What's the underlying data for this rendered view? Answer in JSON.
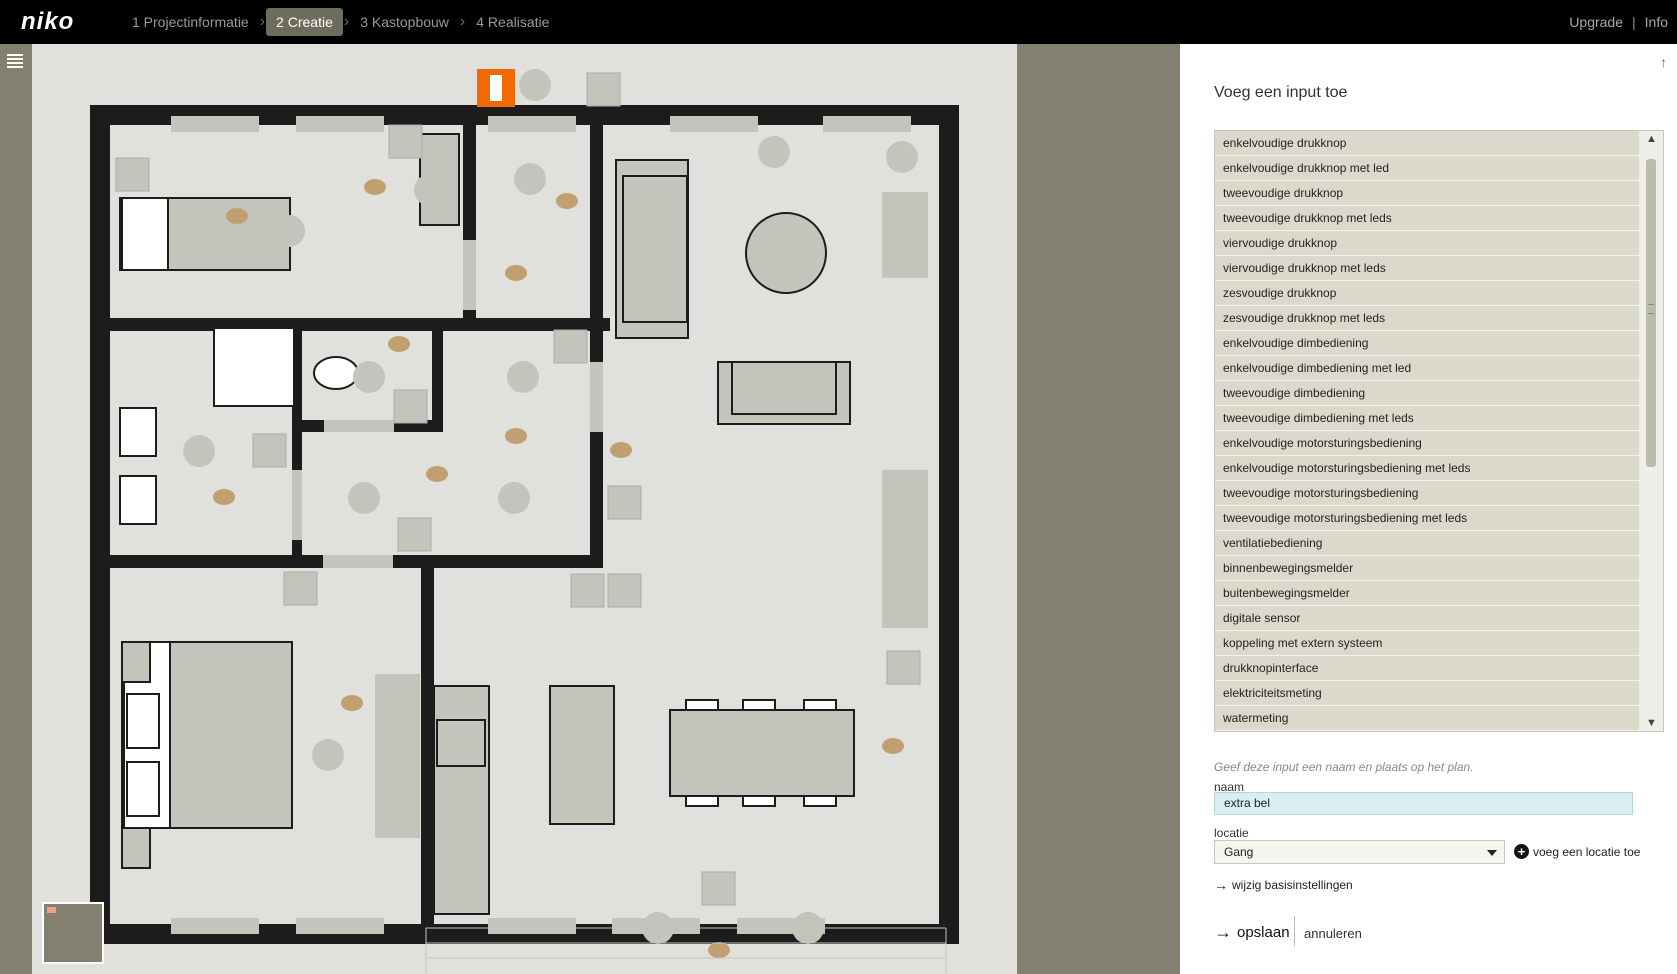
{
  "app": {
    "logo": "niko"
  },
  "steps": [
    {
      "label": "1 Projectinformatie",
      "active": false
    },
    {
      "label": "2 Creatie",
      "active": true
    },
    {
      "label": "3 Kastopbouw",
      "active": false
    },
    {
      "label": "4 Realisatie",
      "active": false
    }
  ],
  "toplinks": {
    "upgrade": "Upgrade",
    "separator": "|",
    "info": "Info"
  },
  "panel": {
    "title": "Voeg een input toe",
    "input_types": [
      "enkelvoudige drukknop",
      "enkelvoudige drukknop met led",
      "tweevoudige drukknop",
      "tweevoudige drukknop met leds",
      "viervoudige drukknop",
      "viervoudige drukknop met leds",
      "zesvoudige drukknop",
      "zesvoudige drukknop met leds",
      "enkelvoudige dimbediening",
      "enkelvoudige dimbediening met led",
      "tweevoudige dimbediening",
      "tweevoudige dimbediening met leds",
      "enkelvoudige motorsturingsbediening",
      "enkelvoudige motorsturingsbediening met leds",
      "tweevoudige motorsturingsbediening",
      "tweevoudige motorsturingsbediening met leds",
      "ventilatiebediening",
      "binnenbewegingsmelder",
      "buitenbewegingsmelder",
      "digitale sensor",
      "koppeling met extern systeem",
      "drukknopinterface",
      "elektriciteitsmeting",
      "watermeting"
    ],
    "hint": "Geef deze input een naam en plaats op het plan.",
    "name_label": "naam",
    "name_value": "extra bel",
    "location_label": "locatie",
    "location_value": "Gang",
    "add_location": "voeg een locatie toe",
    "change_settings": "wijzig basisinstellingen",
    "save": "opslaan",
    "cancel": "annuleren"
  },
  "colors": {
    "topbar": "#000000",
    "olive": "#838070",
    "canvas": "#e0e0dc",
    "wall": "#1c1c1c",
    "furniture": "#c5c4bc",
    "lamp": "#c0a070",
    "active_device": "#f06a00",
    "list_bg": "#dad9cb",
    "input_bg": "#d8eef2"
  }
}
